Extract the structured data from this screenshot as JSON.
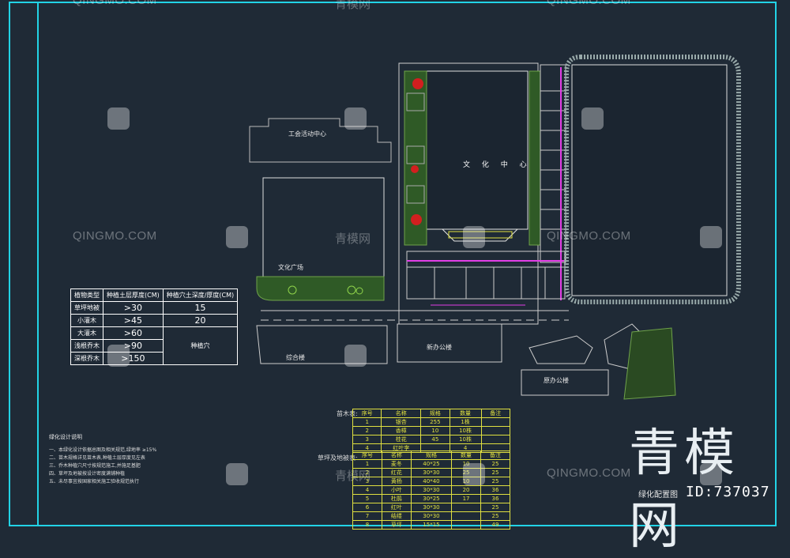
{
  "watermark": {
    "latin": "QINGMO.COM",
    "cn": "青模网"
  },
  "brand": {
    "text": "青模网",
    "id": "ID:737037"
  },
  "plan": {
    "culture_center": "文 化 中 心",
    "drawing_title": "绿化配置图",
    "plaza_label": "文化广场",
    "left_block_label": "工会活动中心",
    "south_block_label": "新办公楼",
    "southwest_block_label": "综合楼",
    "bottom_right_label": "原办公楼",
    "notes_title": "绿化设计说明",
    "label_seedlings": "苗木表:",
    "label_ground": "草坪及地被表:"
  },
  "soil_table": {
    "headers": [
      "植物类型",
      "种植土层厚度(CM)",
      "种植穴土深度/厚度(CM)"
    ],
    "rows": [
      [
        "草坪地被",
        ">30",
        "15"
      ],
      [
        "小灌木",
        ">45",
        "20"
      ],
      [
        "大灌木",
        ">60",
        ""
      ],
      [
        "浅根乔木",
        ">90",
        "种植穴"
      ],
      [
        "深根乔木",
        ">150",
        ""
      ]
    ]
  },
  "plant_table_top": {
    "rows": [
      [
        "序号",
        "名称",
        "规格",
        "数量",
        "备注"
      ],
      [
        "1",
        "银杏",
        "255",
        "1株",
        ""
      ],
      [
        "2",
        "香樟",
        "10",
        "10株",
        ""
      ],
      [
        "3",
        "桂花",
        "45",
        "10株",
        ""
      ],
      [
        "4",
        "红叶李",
        "",
        "4",
        ""
      ]
    ]
  },
  "plant_table_bottom": {
    "rows": [
      [
        "序号",
        "名称",
        "规格",
        "数量",
        "备注"
      ],
      [
        "1",
        "麦冬",
        "40*25",
        "10",
        "25"
      ],
      [
        "2",
        "红花",
        "30*30",
        "25",
        "25"
      ],
      [
        "3",
        "黄杨",
        "40*40",
        "10",
        "25"
      ],
      [
        "4",
        "小叶",
        "30*30",
        "20",
        "36"
      ],
      [
        "5",
        "杜鹃",
        "30*25",
        "17",
        "36"
      ],
      [
        "6",
        "红叶",
        "30*30",
        "",
        "25"
      ],
      [
        "7",
        "结缕",
        "30*30",
        "",
        "25"
      ],
      [
        "8",
        "草坪",
        "15*15",
        "",
        "49"
      ]
    ]
  },
  "colors": {
    "background": "#1f2a36",
    "frame": "#22d3e6",
    "line": "#e8e8e8",
    "magenta": "#e23ee6",
    "green": "#3f7a2a",
    "red": "#d21f1f",
    "yellow": "#e0e040"
  }
}
